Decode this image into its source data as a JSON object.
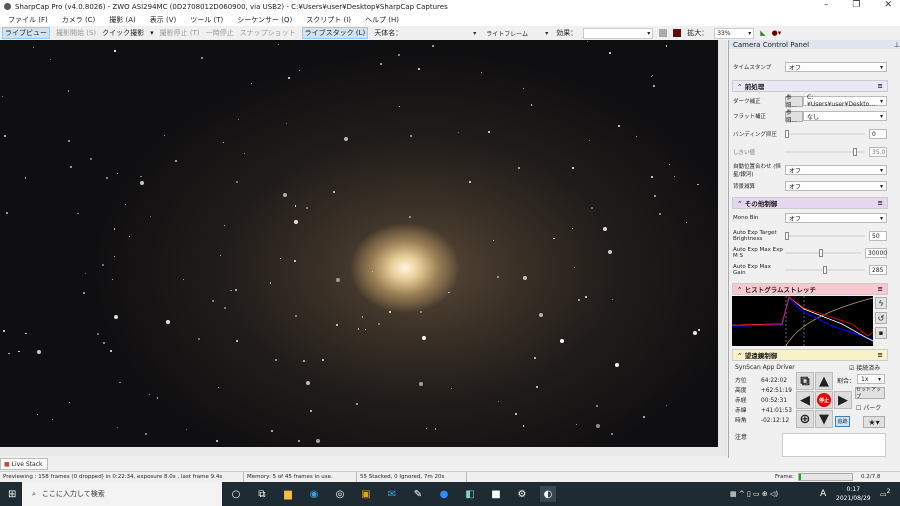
{
  "window": {
    "title": "SharpCap Pro (v4.0.8026) - ZWO ASI294MC (0D2708012D060900, via USB2) - C:¥Users¥user¥Desktop¥SharpCap Captures",
    "minimize": "–",
    "maximize": "❐",
    "close": "✕"
  },
  "menu": [
    "ファイル (F)",
    "カメラ (C)",
    "撮影 (A)",
    "表示 (V)",
    "ツール (T)",
    "シーケンサー (Q)",
    "スクリプト (I)",
    "ヘルプ (H)"
  ],
  "toolbar": {
    "live_view": "ライブビュー",
    "start_capture": "撮影開始 (S)",
    "quick_capture": "クイック撮影",
    "stop_capture": "撮影停止 (T)",
    "pause": "一時停止",
    "snapshot": "スナップショット",
    "live_stack": "ライブスタック (L)",
    "target_label": "天体名：",
    "target_value": "",
    "frame_type": "ライトフレーム",
    "effect_label": "効果：",
    "effect_value": "",
    "zoom_label": "拡大：",
    "zoom_value": "33%"
  },
  "panel": {
    "title": "Camera Control Panel",
    "timestamp_label": "タイムスタンプ",
    "timestamp_value": "オフ",
    "preprocess": {
      "title": "前処理",
      "dark_label": "ダーク補正",
      "browse": "参照...",
      "dark_value": "C:¥Users¥user¥Deskto…",
      "flat_label": "フラット補正",
      "flat_value": "なし",
      "banding_label": "バンディング抑圧",
      "banding_value": "0",
      "threshold_label": "しきい値",
      "threshold_value": "35.0",
      "align_label": "自動位置合わせ (恒星/銀河)",
      "align_value": "オフ",
      "bg_label": "背景減算",
      "bg_value": "オフ"
    },
    "misc": {
      "title": "その他制御",
      "mono_label": "Mono Bin",
      "mono_value": "オフ",
      "target_label": "Auto Exp Target Brightness",
      "target_value": "50",
      "maxexp_label": "Auto Exp Max Exp M S",
      "maxexp_value": "30000",
      "maxgain_label": "Auto Exp Max Gain",
      "maxgain_value": "285"
    },
    "histogram": {
      "title": "ヒストグラムストレッチ"
    },
    "telescope": {
      "title": "望遠鏡制御",
      "driver": "SynScan App Driver",
      "connected": "接続済み",
      "rate_label": "割合：",
      "rate_value": "1x",
      "setup": "セットアップ",
      "park": "パーク",
      "stop": "停止",
      "track": "追跡",
      "coords": [
        {
          "label": "方位",
          "value": "64:22:02"
        },
        {
          "label": "高度",
          "value": "+62:51:19"
        },
        {
          "label": "赤経",
          "value": "00:52:31"
        },
        {
          "label": "赤緯",
          "value": "+41:01:53"
        },
        {
          "label": "時角",
          "value": "-02:12:12"
        }
      ],
      "notes_label": "注意"
    }
  },
  "tabs": {
    "live_stack": "Live Stack"
  },
  "status": {
    "preview": "Previewing : 158 frames (0 dropped) in 0:22:34, exposure 8.0s , last frame 9.4s",
    "memory": "Memory: 5 of 45 frames in use.",
    "stacked": "55 Stacked, 0 Ignored, 7m 20s",
    "frame_label": "Frame:",
    "frame_value": "0.2/7.8"
  },
  "taskbar": {
    "search_placeholder": "ここに入力して検索",
    "time": "0:17",
    "date": "2021/08/29",
    "ime": "A",
    "notif": "2"
  }
}
